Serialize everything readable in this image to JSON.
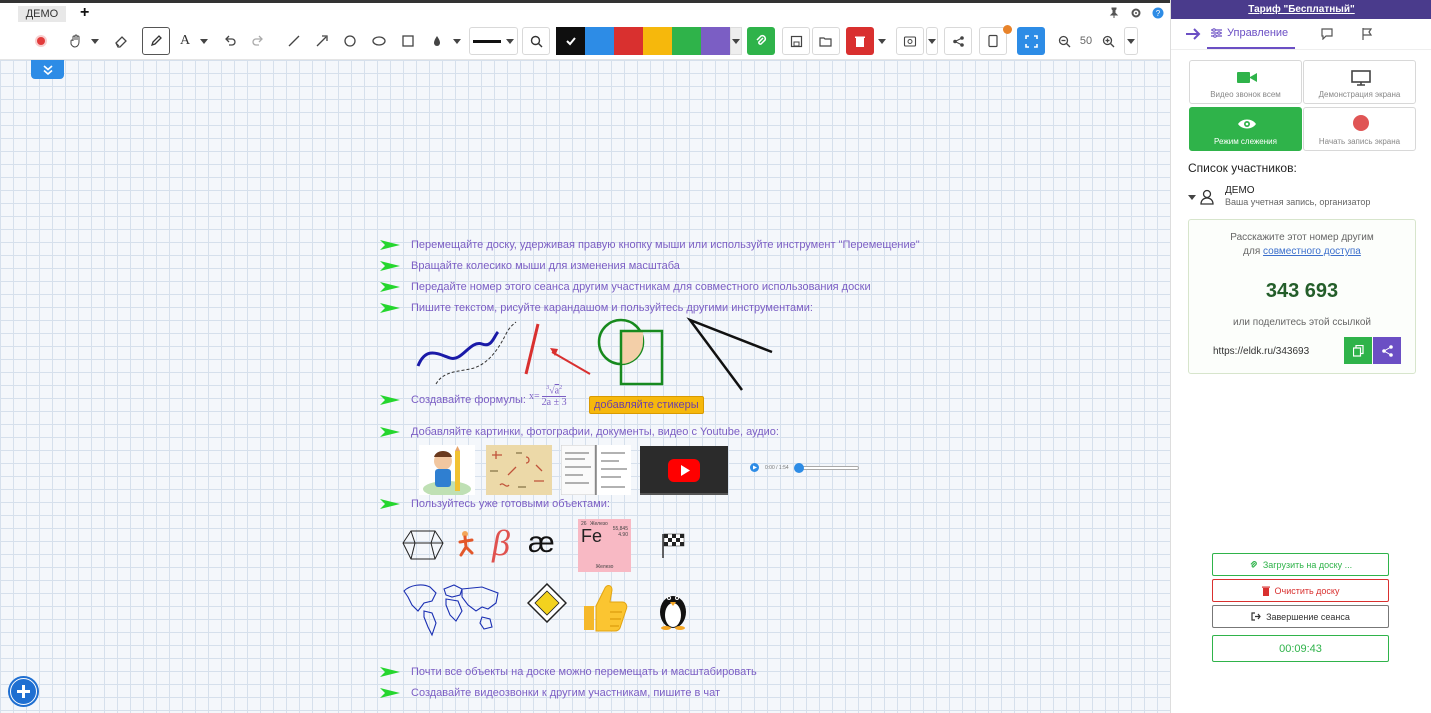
{
  "tabs": {
    "current": "ДЕМО",
    "add": "+"
  },
  "toolbar": {
    "zoom": "50"
  },
  "colors": {
    "accent": "#2d8ce6",
    "green": "#2fb34a",
    "red": "#d9302f",
    "purple": "#7b5ec4",
    "text_purple": "#7b5ec4",
    "palette": [
      "#0f0f0f",
      "#2d8ce6",
      "#d9302f",
      "#f6b80c",
      "#2fb34a",
      "#7b5ec4"
    ]
  },
  "board": {
    "bullets": [
      "Перемещайте доску, удерживая правую кнопку мыши или используйте инструмент \"Перемещение\"",
      "Вращайте колесико мыши для изменения масштаба",
      "Передайте номер этого сеанса другим участникам для совместного использования доски",
      "Пишите текстом, рисуйте карандашом и пользуйтесь другими инструментами:",
      "Создавайте формулы:",
      "Добавляйте картинки, фотографии, документы, видео с Youtube, аудио:",
      "Пользуйтесь уже готовыми объектами:",
      "Почти все объекты на доске можно перемещать и масштабировать",
      "Создавайте видеозвонки к другим участникам, пишите в чат"
    ],
    "formula": {
      "x": "x=",
      "num": "a",
      "num_exp": "2",
      "root": "3",
      "den": "2a ± 3"
    },
    "sticker": "добавляйте стикеры",
    "audio_time": "0:00 / 1:54",
    "element": {
      "symbol": "Fe",
      "number": "26",
      "name": "Железо",
      "mass": "55,845",
      "extra": "4.90",
      "footer": "Железо"
    },
    "ligature": "æ"
  },
  "panel": {
    "tariff": "Тариф \"Бесплатный\"",
    "tab_control": "Управление",
    "tiles": {
      "video_all": "Видео звонок всем",
      "screen_demo": "Демонстрация экрана",
      "tracking": "Режим слежения",
      "record": "Начать запись экрана"
    },
    "participants_title": "Список участников:",
    "participant": {
      "name": "ДЕМО",
      "role": "Ваша учетная запись, организатор"
    },
    "share": {
      "line1": "Расскажите этот номер другим",
      "line2a": "для ",
      "line2b": "совместного доступа",
      "number": "343 693",
      "or_link": "или поделитесь этой ссылкой",
      "url": "https://eldk.ru/343693"
    },
    "buttons": {
      "upload": "Загрузить на доску ...",
      "clear": "Очистить доску",
      "end": "Завершение сеанса",
      "timer": "00:09:43"
    }
  }
}
